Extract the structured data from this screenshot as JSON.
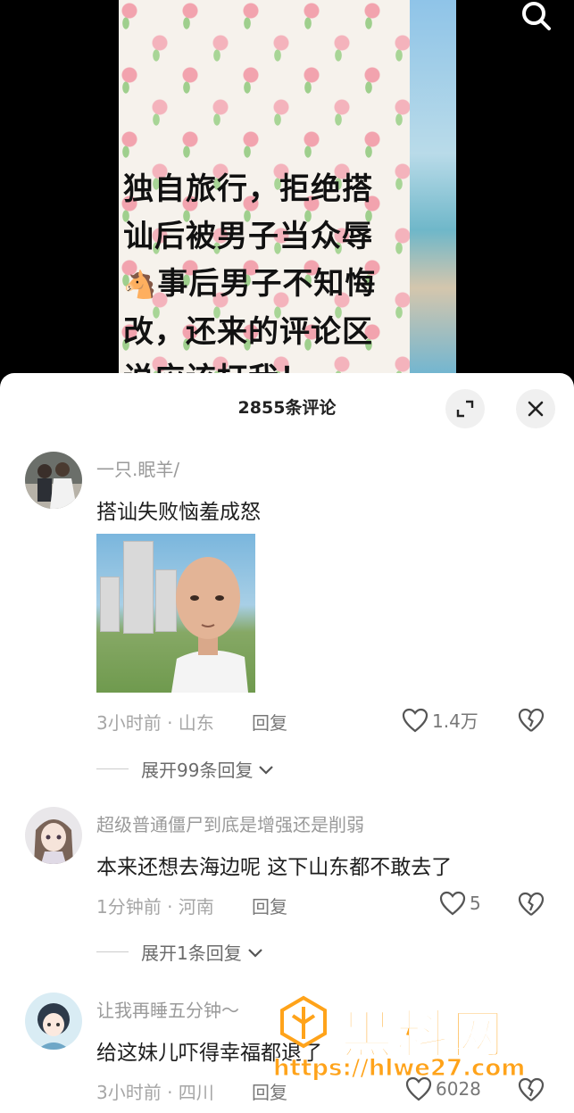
{
  "video": {
    "lines": [
      "独自旅行，拒绝搭",
      "讪后被男子当众辱",
      "事后男子不知悔",
      "改，还来的评论区",
      "说应该打我！"
    ],
    "emoji": "🐴"
  },
  "sheet": {
    "title": "2855条评论"
  },
  "comments": [
    {
      "username": "一只.眠羊/",
      "text": "搭讪失败恼羞成怒",
      "meta": "3小时前 · 山东",
      "reply": "回复",
      "likes": "1.4万",
      "expand": "展开99条回复"
    },
    {
      "username": "超级普通僵尸到底是增强还是削弱",
      "text": "本来还想去海边呢 这下山东都不敢去了",
      "meta": "1分钟前 · 河南",
      "reply": "回复",
      "likes": "5",
      "expand": "展开1条回复"
    },
    {
      "username": "让我再睡五分钟～",
      "text": "给这妹儿吓得幸福都退了",
      "meta": "3小时前 · 四川",
      "reply": "回复",
      "likes": "6028"
    }
  ],
  "watermark": {
    "title": "黑料网",
    "url": "https://hlwe27.com"
  }
}
